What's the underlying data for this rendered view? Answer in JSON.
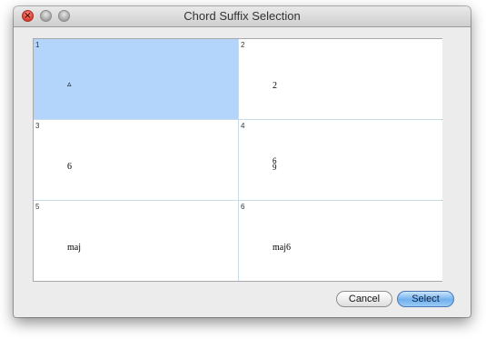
{
  "window": {
    "title": "Chord Suffix Selection"
  },
  "colors": {
    "selected_cell": "#b3d4fb",
    "close_button": "#d83a2c",
    "default_button": "#6fb0ee"
  },
  "titlebar": {
    "close_symbol": "×"
  },
  "grid": {
    "cells": [
      {
        "index": "1",
        "symbol": "▵",
        "icon": "triangle-major-icon",
        "selected": true
      },
      {
        "index": "2",
        "symbol": "2",
        "selected": false
      },
      {
        "index": "3",
        "symbol": "6",
        "selected": false
      },
      {
        "index": "4",
        "symbol_top": "6",
        "symbol_bottom": "9",
        "selected": false
      },
      {
        "index": "5",
        "symbol": "maj",
        "selected": false
      },
      {
        "index": "6",
        "symbol": "maj6",
        "selected": false
      }
    ]
  },
  "buttons": {
    "cancel_label": "Cancel",
    "select_label": "Select"
  }
}
